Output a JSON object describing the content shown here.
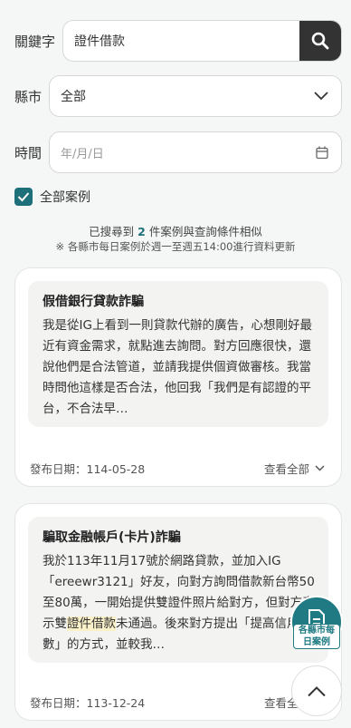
{
  "search": {
    "label": "關鍵字",
    "value": "證件借款"
  },
  "city": {
    "label": "縣市",
    "selected": "全部"
  },
  "date": {
    "label": "時間",
    "placeholder": "年/月/日"
  },
  "all_cases": {
    "label": "全部案例",
    "checked": true
  },
  "summary": {
    "prefix": "已搜尋到 ",
    "count": "2",
    "suffix": " 件案例與查詢條件相似",
    "note": "※ 各縣市每日案例於週一至週五14:00進行資料更新"
  },
  "cases": [
    {
      "title": "假借銀行貸款詐騙",
      "body": "我是從IG上看到一則貸款代辦的廣告，心想剛好最近有資金需求，就點進去詢問。對方回應很快，還說他們是合法管道，並請我提供個資做審核。我當時問他這樣是否合法，他回我「我們是有認證的平台，不合法早…",
      "date_label": "發布日期：114-05-28",
      "view_all": "查看全部"
    },
    {
      "title": "騙取金融帳戶(卡片)詐騙",
      "body_before": "我於113年11月17號於網路貸款，並加入IG「ereewr3121」好友，向對方詢問借款新台幣50至80萬，一開始提供雙證件照片給對方，但對方表示雙",
      "body_highlight": "證件借款",
      "body_after": "未通過。後來對方提出「提高信用分數」的方式，並較我…",
      "date_label": "發布日期：113-12-24",
      "view_all": "查看全部"
    }
  ],
  "fab": {
    "daily_label": "各縣市每日案例"
  },
  "colors": {
    "accent": "#1d6f7a",
    "dark_button": "#333333",
    "highlight": "#fbf1c9"
  }
}
